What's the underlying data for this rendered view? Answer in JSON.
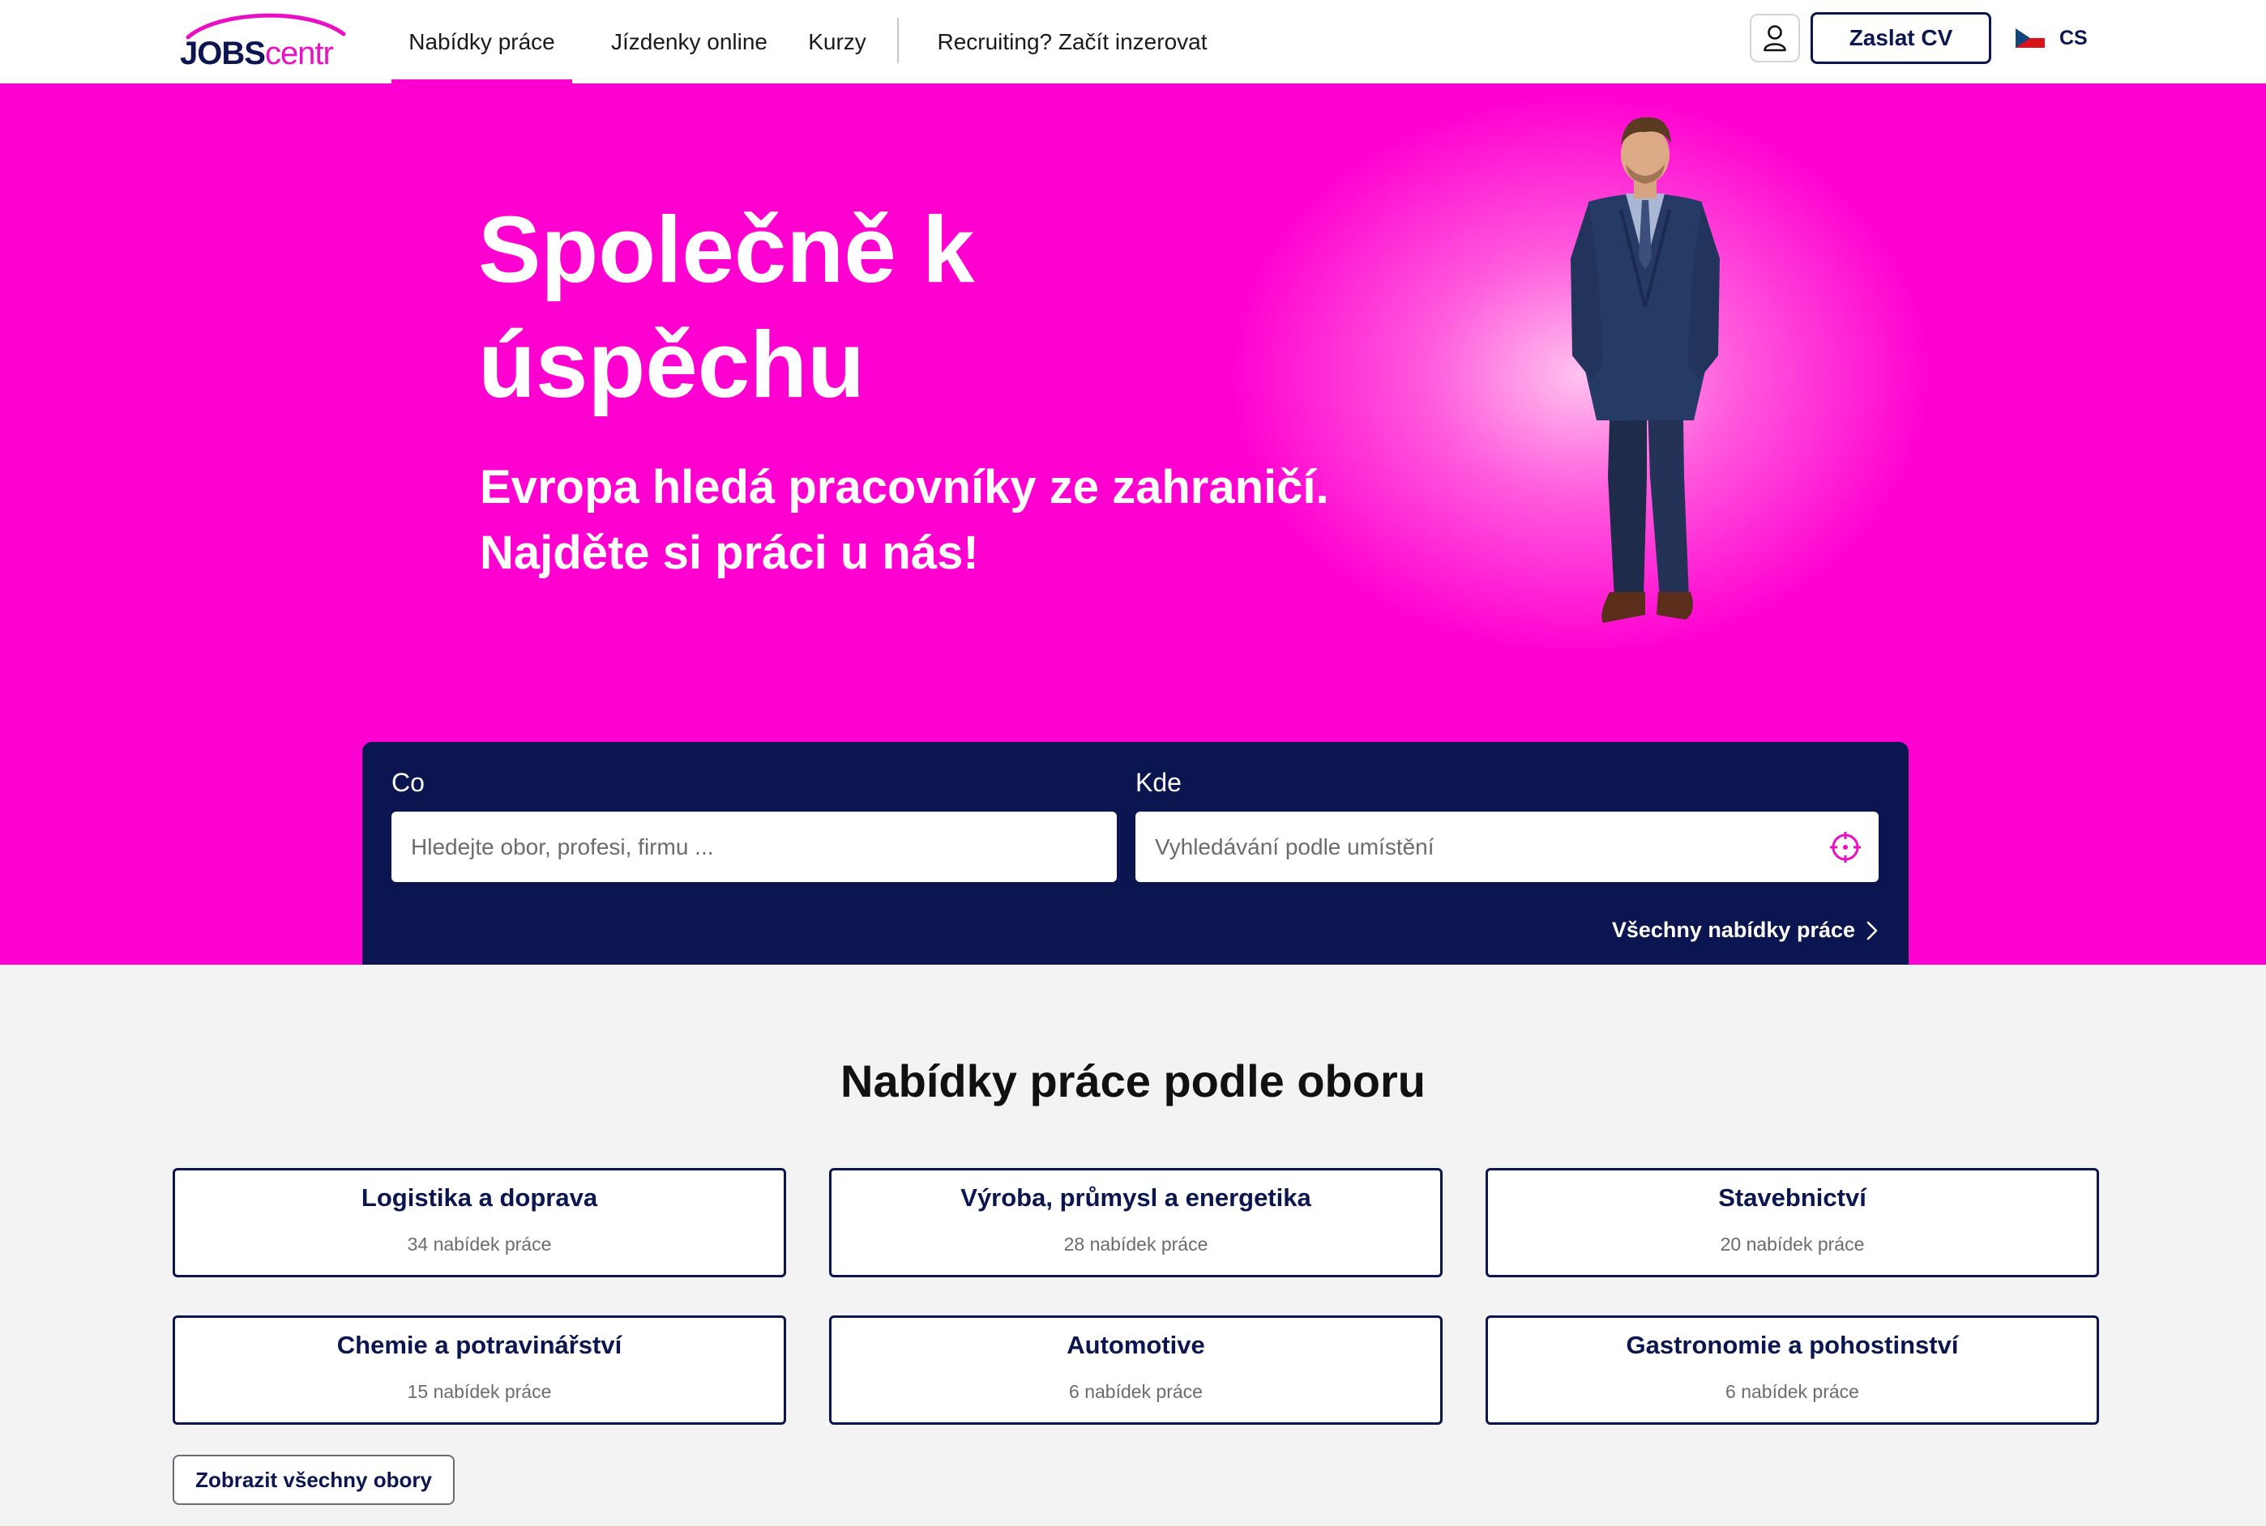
{
  "header": {
    "logo_bold": "JOBS",
    "logo_light": "centr",
    "nav": [
      {
        "label": "Nabídky práce",
        "active": true
      },
      {
        "label": "Jízdenky online",
        "active": false
      },
      {
        "label": "Kurzy",
        "active": false
      },
      {
        "label": "Recruiting? Začít inzerovat",
        "active": false
      }
    ],
    "user_icon": "user-icon",
    "cv_button": "Zaslat CV",
    "language_code": "CS",
    "language_flag": "czech-flag-icon"
  },
  "hero": {
    "title": "Společně k úspěchu",
    "subtitle_line1": "Evropa hledá pracovníky ze zahraničí.",
    "subtitle_line2": "Najděte si práci u nás!"
  },
  "search": {
    "what_label": "Co",
    "what_placeholder": "Hledejte obor, profesi, firmu ...",
    "where_label": "Kde",
    "where_placeholder": "Vyhledávání podle umístění",
    "all_offers_link": "Všechny nabídky práce"
  },
  "categories": {
    "title": "Nabídky práce podle oboru",
    "items": [
      {
        "name": "Logistika a doprava",
        "count": "34 nabídek práce"
      },
      {
        "name": "Výroba, průmysl a energetika",
        "count": "28 nabídek práce"
      },
      {
        "name": "Stavebnictví",
        "count": "20 nabídek práce"
      },
      {
        "name": "Chemie a potravinářství",
        "count": "15 nabídek práce"
      },
      {
        "name": "Automotive",
        "count": "6 nabídek práce"
      },
      {
        "name": "Gastronomie a pohostinství",
        "count": "6 nabídek práce"
      }
    ],
    "show_all_button": "Zobrazit všechny obory"
  },
  "colors": {
    "brand_magenta": "#ff00d0",
    "brand_navy": "#0b1550",
    "page_background": "#f3f3f4"
  }
}
